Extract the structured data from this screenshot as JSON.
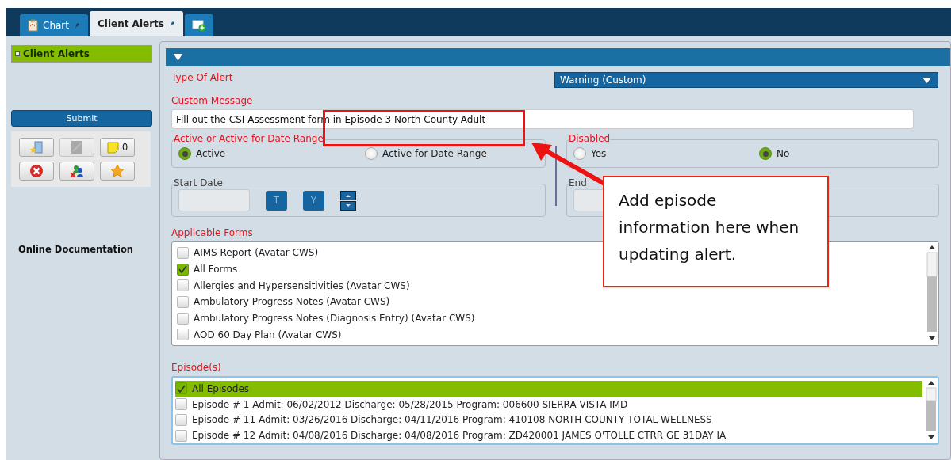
{
  "tabs": [
    {
      "label": "Chart",
      "selected": false
    },
    {
      "label": "Client Alerts",
      "selected": true
    }
  ],
  "sidebar": {
    "items": [
      {
        "label": "Client Alerts",
        "selected": true
      }
    ],
    "submit": "Submit",
    "tool_buttons": [
      {
        "kind": "star-doc",
        "disabled": false
      },
      {
        "kind": "page",
        "disabled": true
      },
      {
        "kind": "note",
        "disabled": false,
        "count": "0"
      },
      {
        "kind": "delete",
        "disabled": false
      },
      {
        "kind": "people",
        "disabled": false
      },
      {
        "kind": "star",
        "disabled": false
      }
    ],
    "link": "Online Documentation"
  },
  "form": {
    "type_of_alert": {
      "label": "Type Of Alert",
      "value": "Warning (Custom)"
    },
    "custom_message": {
      "label": "Custom Message",
      "value": "Fill out the CSI Assessment form in Episode 3 North County Adult"
    },
    "status": {
      "label": "Active or Active for Date Range",
      "options": [
        {
          "label": "Active",
          "selected": true
        },
        {
          "label": "Active for Date Range",
          "selected": false
        }
      ]
    },
    "disabled": {
      "label": "Disabled",
      "options": [
        {
          "label": "Yes",
          "selected": false
        },
        {
          "label": "No",
          "selected": true
        }
      ]
    },
    "start_date": {
      "label": "Start Date",
      "buttons": [
        "T",
        "Y"
      ]
    },
    "end_date": {
      "label": "End"
    },
    "forms": {
      "label": "Applicable Forms",
      "items": [
        {
          "label": "AIMS Report (Avatar CWS)",
          "checked": false
        },
        {
          "label": "All Forms",
          "checked": true
        },
        {
          "label": "Allergies and Hypersensitivities (Avatar CWS)",
          "checked": false
        },
        {
          "label": "Ambulatory Progress Notes (Avatar CWS)",
          "checked": false
        },
        {
          "label": "Ambulatory Progress Notes (Diagnosis Entry) (Avatar CWS)",
          "checked": false
        },
        {
          "label": "AOD 60 Day Plan (Avatar CWS)",
          "checked": false
        }
      ]
    },
    "episodes": {
      "label": "Episode(s)",
      "items": [
        {
          "label": "All Episodes",
          "checked": true,
          "selected": true
        },
        {
          "label": "Episode # 1 Admit: 06/02/2012 Discharge: 05/28/2015 Program: 006600 SIERRA VISTA IMD",
          "checked": false,
          "selected": false
        },
        {
          "label": "Episode # 11 Admit: 03/26/2016 Discharge: 04/11/2016 Program: 410108 NORTH COUNTY TOTAL WELLNESS",
          "checked": false,
          "selected": false
        },
        {
          "label": "Episode # 12 Admit: 04/08/2016 Discharge: 04/08/2016 Program: ZD420001 JAMES O'TOLLE CTRR GE 31DAY IA",
          "checked": false,
          "selected": false
        }
      ]
    }
  },
  "callout": {
    "text": "Add episode information here when updating alert."
  }
}
